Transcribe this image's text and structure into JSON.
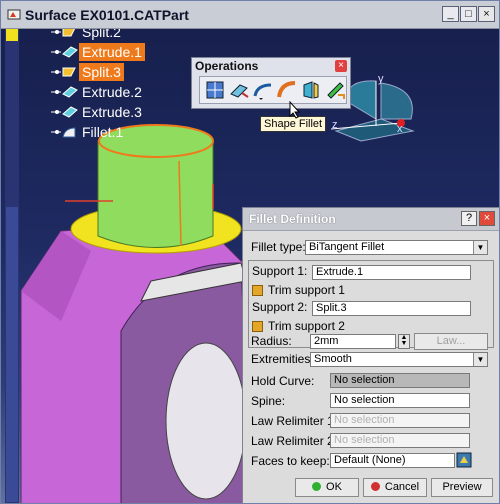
{
  "window": {
    "title": "Surface EX0101.CATPart",
    "minimize_glyph": "_",
    "maximize_glyph": "□",
    "close_glyph": "×"
  },
  "tree": {
    "items": [
      {
        "label": "Split.2",
        "selected": false,
        "icon": "split-icon"
      },
      {
        "label": "Extrude.1",
        "selected": true,
        "icon": "extrude-icon"
      },
      {
        "label": "Split.3",
        "selected": true,
        "icon": "split-icon"
      },
      {
        "label": "Extrude.2",
        "selected": false,
        "icon": "extrude-icon"
      },
      {
        "label": "Extrude.3",
        "selected": false,
        "icon": "extrude-icon"
      },
      {
        "label": "Fillet.1",
        "selected": false,
        "icon": "fillet-icon"
      }
    ]
  },
  "toolbar": {
    "title": "Operations",
    "close_glyph": "×",
    "tools": [
      "join-icon",
      "split-trim-icon",
      "fillet-icon",
      "shape-fillet-icon",
      "extrapolate-icon",
      "transform-icon"
    ],
    "tooltip": "Shape Fillet"
  },
  "compass": {
    "x_label": "x",
    "y_label": "y",
    "z_label": "z"
  },
  "dialog": {
    "title": "Fillet Definition",
    "help_glyph": "?",
    "close_glyph": "×",
    "fillet_type_label": "Fillet type:",
    "fillet_type_value": "BiTangent Fillet",
    "support1_label": "Support 1:",
    "support1_value": "Extrude.1",
    "trim_support1_label": "Trim support 1",
    "support2_label": "Support 2:",
    "support2_value": "Split.3",
    "trim_support2_label": "Trim support 2",
    "radius_label": "Radius:",
    "radius_value": "2mm",
    "law_button": "Law...",
    "extremities_label": "Extremities:",
    "extremities_value": "Smooth",
    "hold_curve_label": "Hold Curve:",
    "hold_curve_value": "No selection",
    "spine_label": "Spine:",
    "spine_value": "No selection",
    "law_relimiter1_label": "Law Relimiter 1:",
    "law_relimiter1_value": "No selection",
    "law_relimiter2_label": "Law Relimiter 2:",
    "law_relimiter2_value": "No selection",
    "faces_label": "Faces to keep:",
    "faces_value": "Default (None)",
    "ok_label": "OK",
    "cancel_label": "Cancel",
    "preview_label": "Preview"
  },
  "colors": {
    "selection": "#ef7a1b",
    "background": "#1b2250",
    "cylinder": "#8fdc5e",
    "fillet_ring": "#f2e320",
    "pink_surface": "#cc6fd8"
  }
}
